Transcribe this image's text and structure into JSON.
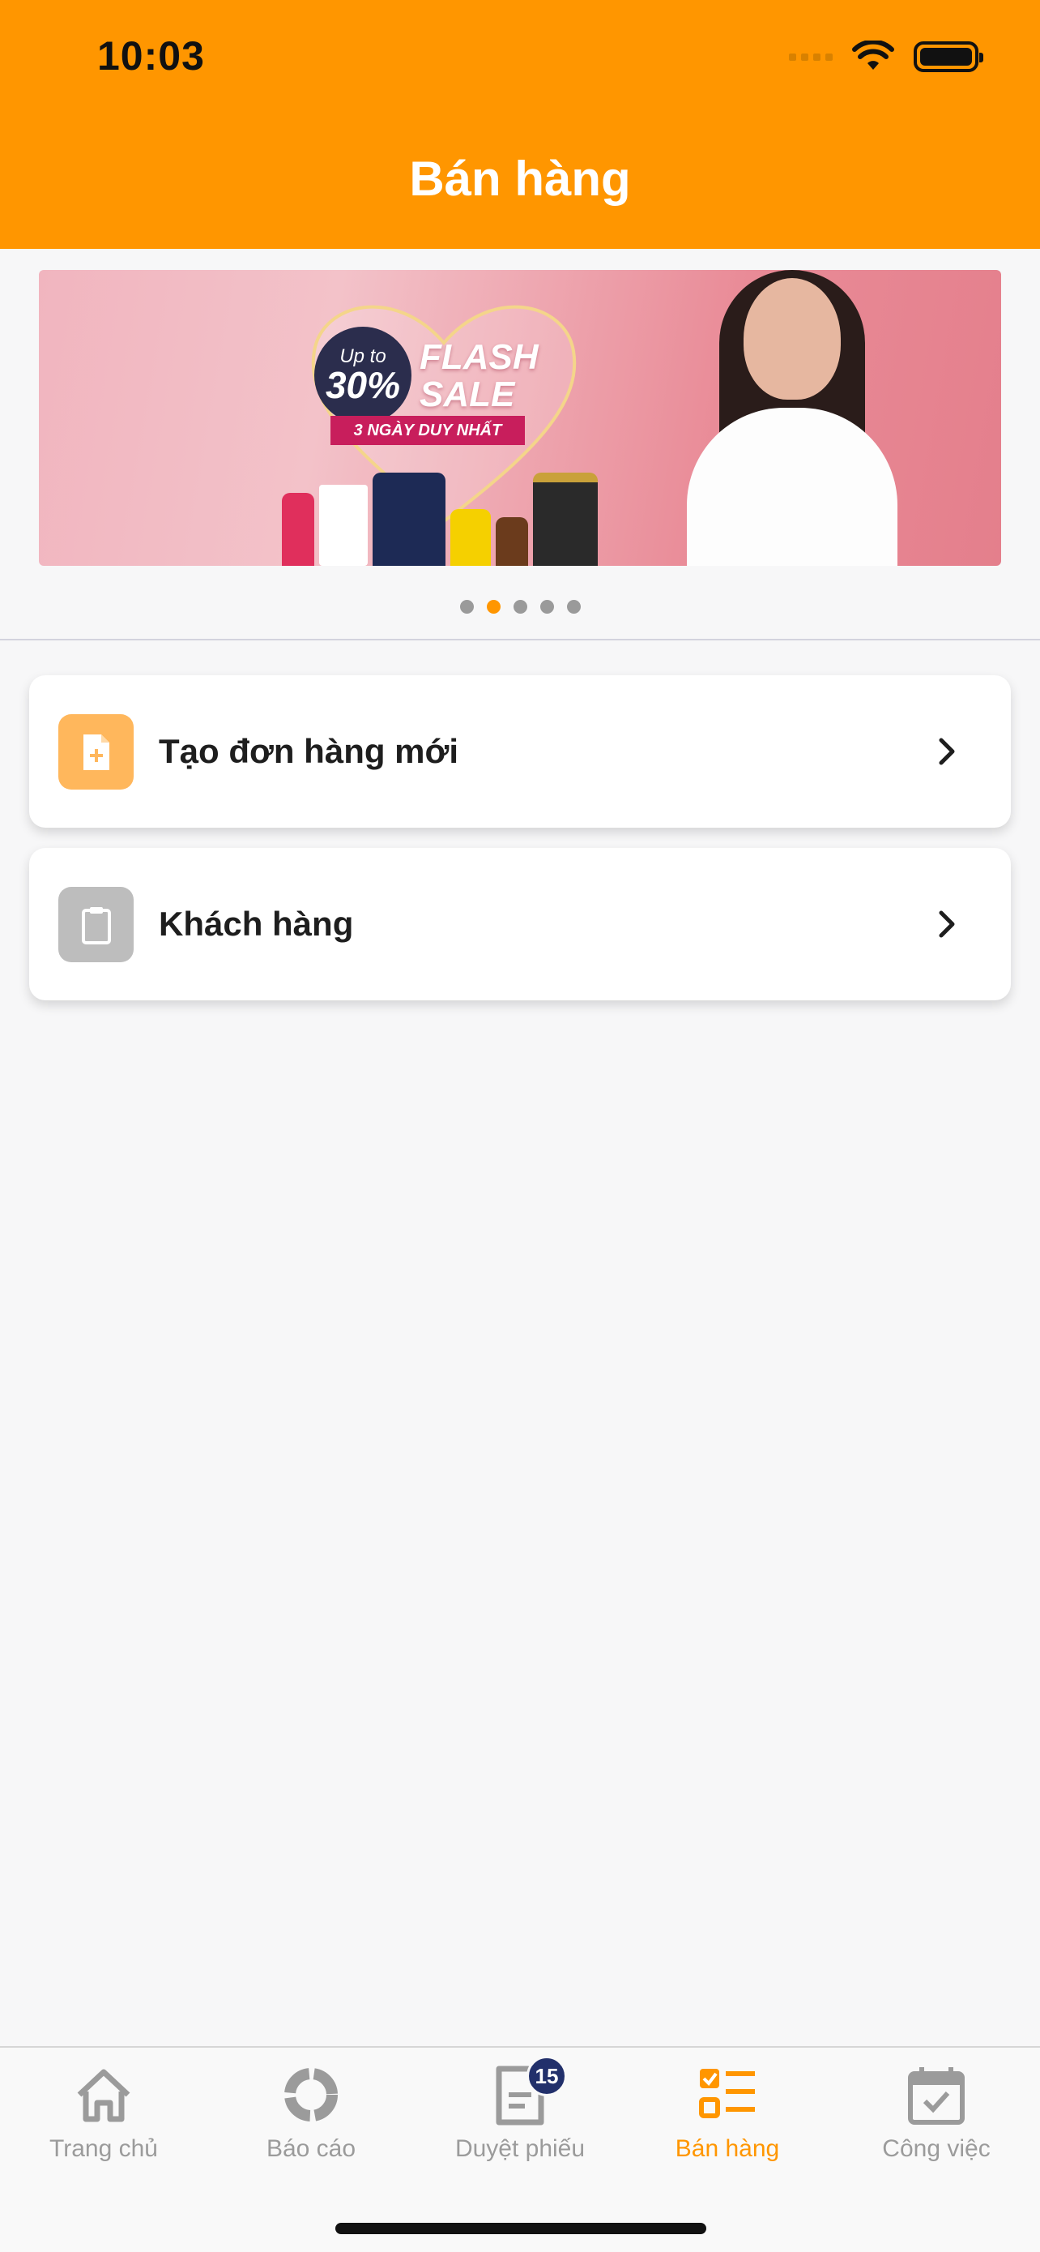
{
  "status_bar": {
    "time": "10:03"
  },
  "header": {
    "title": "Bán hàng"
  },
  "banner": {
    "badge_small": "Up to",
    "badge_big": "30%",
    "flash_line1": "FLASH",
    "flash_line2": "SALE",
    "ribbon": "3 NGÀY DUY NHẤT",
    "slide_count": 5,
    "active_slide": 2
  },
  "menu": [
    {
      "label": "Tạo đơn hàng mới",
      "icon": "new-document-icon",
      "icon_bg": "#FFB75C"
    },
    {
      "label": "Khách hàng",
      "icon": "clipboard-icon",
      "icon_bg": "#BDBDBD"
    }
  ],
  "tabbar": {
    "items": [
      {
        "label": "Trang chủ",
        "icon": "home-icon"
      },
      {
        "label": "Báo cáo",
        "icon": "report-chart-icon"
      },
      {
        "label": "Duyệt phiếu",
        "icon": "document-icon",
        "badge": "15"
      },
      {
        "label": "Bán hàng",
        "icon": "checklist-icon"
      },
      {
        "label": "Công việc",
        "icon": "calendar-check-icon"
      }
    ],
    "active_index": 3
  },
  "colors": {
    "accent": "#FF9600",
    "badge": "#22306B",
    "inactive": "#9B9B9B"
  }
}
